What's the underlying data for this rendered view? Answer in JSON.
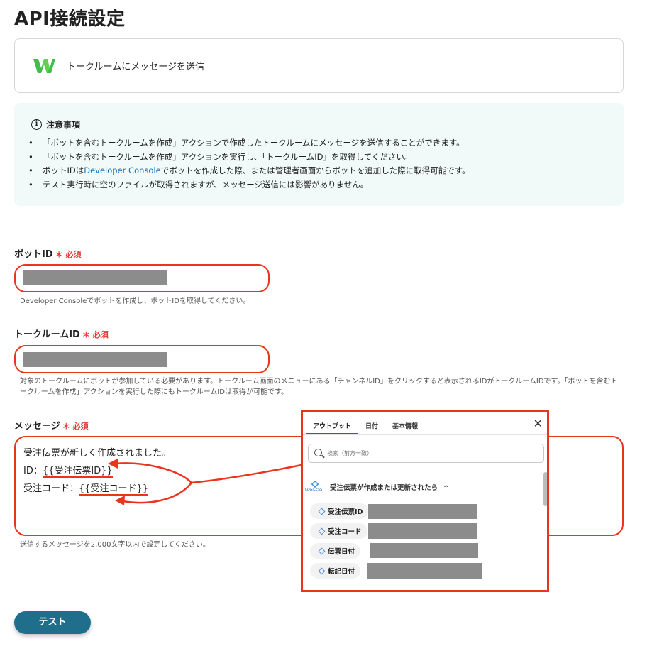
{
  "page": {
    "title": "API接続設定"
  },
  "action": {
    "label": "トークルームにメッセージを送信"
  },
  "notice": {
    "title": "注意事項",
    "items": [
      "「ボットを含むトークルームを作成」アクションで作成したトークルームにメッセージを送信することができます。",
      "「ボットを含むトークルームを作成」アクションを実行し、「トークルームID」を取得してください。",
      "テスト実行時に空のファイルが取得されますが、メッセージ送信には影響がありません。"
    ],
    "item3_prefix": "ボットIDは",
    "item3_link": "Developer Console",
    "item3_suffix": "でボットを作成した際、または管理者画面からボットを追加した際に取得可能です。"
  },
  "fields": {
    "required_mark": "＊ 必須",
    "bot_id": {
      "label": "ボットID",
      "hint": "Developer Consoleでボットを作成し、ボットIDを取得してください。"
    },
    "room_id": {
      "label": "トークルームID",
      "hint_line1": "対象のトークルームにボットが参加している必要があります。トークルーム画面のメニューにある「チャンネルID」をクリックすると表示されるIDがトークルームIDです。「ボットを含むト",
      "hint_line2": "ークルームを作成」アクションを実行した際にもトークルームIDは取得が可能です。"
    },
    "message": {
      "label": "メッセージ",
      "line1": "受注伝票が新しく作成されました。",
      "line2_prefix": "ID：",
      "line2_var": "{{受注伝票ID}}",
      "line3_prefix": "受注コード：",
      "line3_var": "{{受注コード}}",
      "hint": "送信するメッセージを2,000文字以内で設定してください。"
    }
  },
  "popup": {
    "tabs": [
      "アウトプット",
      "日付",
      "基本情報"
    ],
    "active_tab": 0,
    "close_label": "✕",
    "search_placeholder": "検索（前方一致）",
    "source_caption": "LOGILESS",
    "source_title": "受注伝票が作成または更新されたら",
    "source_chevron": "^",
    "items": [
      "受注伝票ID",
      "受注コード",
      "伝票日付",
      "転記日付"
    ]
  },
  "test_button": {
    "label": "テスト"
  },
  "colors": {
    "accent": "#1f6e8c",
    "highlight": "#e8351c",
    "required": "#e53935",
    "link": "#1a6fb5",
    "logo_green": "#3fbe4d"
  },
  "icons": {
    "info": "info-circle-icon",
    "search": "search-icon",
    "close": "close-icon",
    "chevron": "chevron-up-icon",
    "app": "lineworks-logo-icon"
  }
}
